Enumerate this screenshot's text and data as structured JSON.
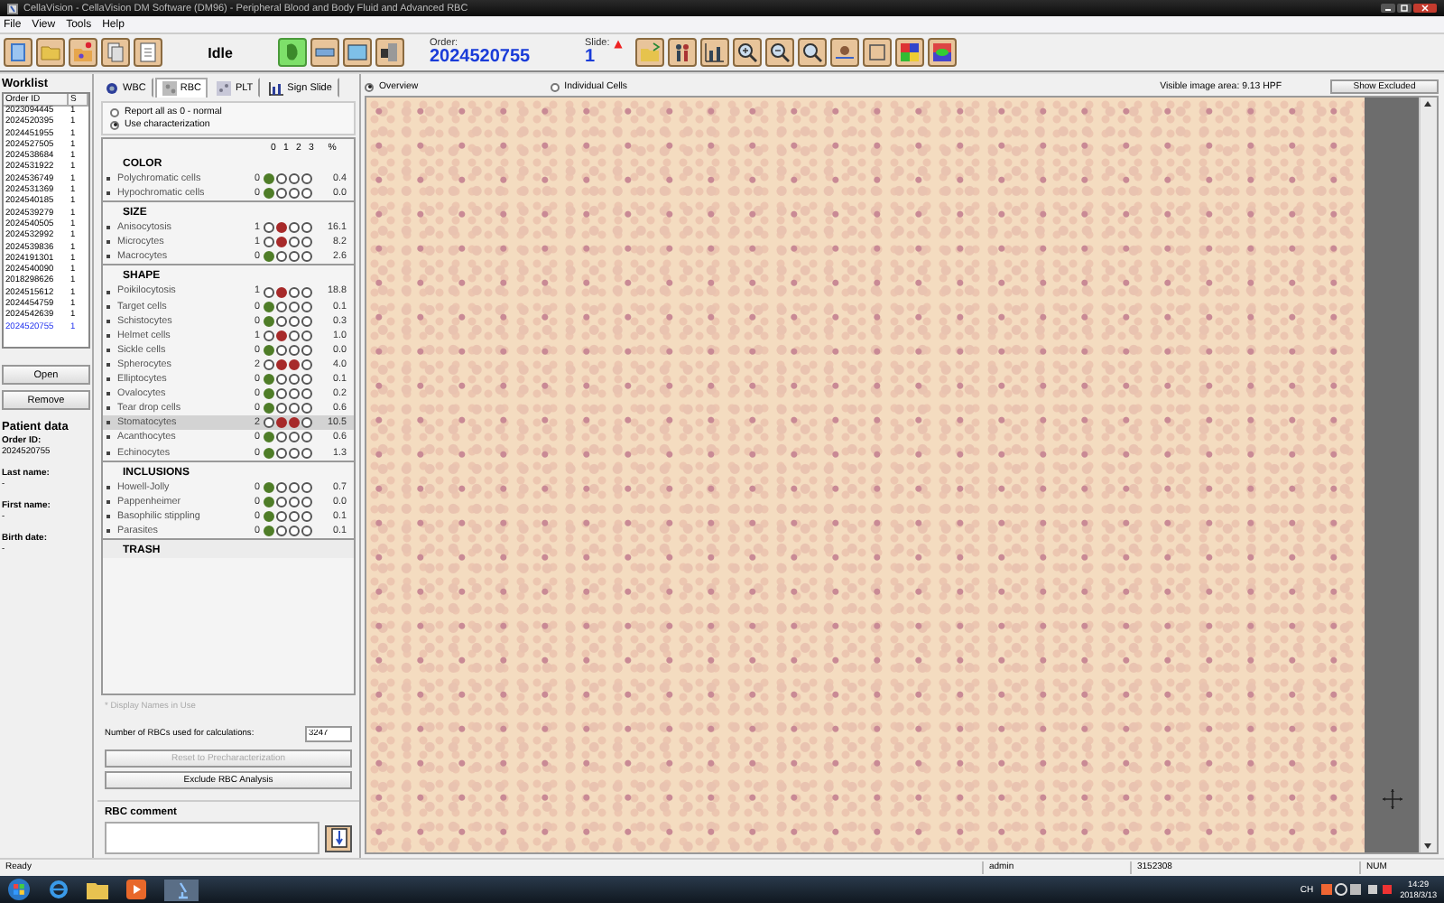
{
  "window": {
    "title": "CellaVision - CellaVision DM Software (DM96) - Peripheral Blood and Body Fluid and Advanced RBC"
  },
  "menu": [
    "File",
    "View",
    "Tools",
    "Help"
  ],
  "toolbar": {
    "status": "Idle",
    "order_label": "Order:",
    "order": "2024520755",
    "slide_label": "Slide:",
    "slide": "1",
    "mode_buttons": [
      {
        "selected": true
      },
      {
        "selected": false
      },
      {
        "selected": false
      },
      {
        "selected": false
      }
    ]
  },
  "worklist": {
    "title": "Worklist",
    "columns": [
      "Order ID",
      "S"
    ],
    "rows": [
      {
        "order": "2023094445",
        "s": "1",
        "selected": false
      },
      {
        "order": "2024520395",
        "s": "1",
        "selected": false
      },
      {
        "order": "2024451955",
        "s": "1",
        "selected": false
      },
      {
        "order": "2024527505",
        "s": "1",
        "selected": false
      },
      {
        "order": "2024538684",
        "s": "1",
        "selected": false
      },
      {
        "order": "2024531922",
        "s": "1",
        "selected": false
      },
      {
        "order": "2024536749",
        "s": "1",
        "selected": false
      },
      {
        "order": "2024531369",
        "s": "1",
        "selected": false
      },
      {
        "order": "2024540185",
        "s": "1",
        "selected": false
      },
      {
        "order": "2024539279",
        "s": "1",
        "selected": false
      },
      {
        "order": "2024540505",
        "s": "1",
        "selected": false
      },
      {
        "order": "2024532992",
        "s": "1",
        "selected": false
      },
      {
        "order": "2024539836",
        "s": "1",
        "selected": false
      },
      {
        "order": "2024191301",
        "s": "1",
        "selected": false
      },
      {
        "order": "2024540090",
        "s": "1",
        "selected": false
      },
      {
        "order": "2018298626",
        "s": "1",
        "selected": false
      },
      {
        "order": "2024515612",
        "s": "1",
        "selected": false
      },
      {
        "order": "2024454759",
        "s": "1",
        "selected": false
      },
      {
        "order": "2024542639",
        "s": "1",
        "selected": false
      },
      {
        "order": "2024520755",
        "s": "1",
        "selected": true
      }
    ],
    "buttons": [
      "Open",
      "Remove"
    ]
  },
  "patient": {
    "title": "Patient data",
    "fields": [
      {
        "label": "Order ID:",
        "value": "2024520755"
      },
      {
        "label": "Last name:",
        "value": "-"
      },
      {
        "label": "First name:",
        "value": "-"
      },
      {
        "label": "Birth date:",
        "value": "-"
      }
    ]
  },
  "tabs": [
    {
      "label": "WBC",
      "selected": false
    },
    {
      "label": "RBC",
      "selected": true
    },
    {
      "label": "PLT",
      "selected": false
    },
    {
      "label": "Sign Slide",
      "selected": false
    }
  ],
  "report_options": [
    {
      "label": "Report all as 0 - normal",
      "selected": false
    },
    {
      "label": "Use characterization",
      "selected": true
    }
  ],
  "grade_header": [
    "0",
    "1",
    "2",
    "3",
    "%"
  ],
  "categories": [
    {
      "title": "COLOR",
      "rows": [
        {
          "name": "Polychromatic cells",
          "grade": "0",
          "percent": "0.4",
          "selected": false
        },
        {
          "name": "Hypochromatic cells",
          "grade": "0",
          "percent": "0.0",
          "selected": false
        }
      ]
    },
    {
      "title": "SIZE",
      "rows": [
        {
          "name": "Anisocytosis",
          "grade": "1",
          "percent": "16.1",
          "selected": false
        },
        {
          "name": "Microcytes",
          "grade": "1",
          "percent": "8.2",
          "selected": false
        },
        {
          "name": "Macrocytes",
          "grade": "0",
          "percent": "2.6",
          "selected": false
        }
      ]
    },
    {
      "title": "SHAPE",
      "rows": [
        {
          "name": "Poikilocytosis",
          "grade": "1",
          "percent": "18.8",
          "selected": false
        },
        {
          "name": "Target cells",
          "grade": "0",
          "percent": "0.1",
          "selected": false
        },
        {
          "name": "Schistocytes",
          "grade": "0",
          "percent": "0.3",
          "selected": false
        },
        {
          "name": "Helmet cells",
          "grade": "1",
          "percent": "1.0",
          "selected": false
        },
        {
          "name": "Sickle cells",
          "grade": "0",
          "percent": "0.0",
          "selected": false
        },
        {
          "name": "Spherocytes",
          "grade": "2",
          "percent": "4.0",
          "selected": false
        },
        {
          "name": "Elliptocytes",
          "grade": "0",
          "percent": "0.1",
          "selected": false
        },
        {
          "name": "Ovalocytes",
          "grade": "0",
          "percent": "0.2",
          "selected": false
        },
        {
          "name": "Tear drop cells",
          "grade": "0",
          "percent": "0.6",
          "selected": false
        },
        {
          "name": "Stomatocytes",
          "grade": "2",
          "percent": "10.5",
          "selected": true
        },
        {
          "name": "Acanthocytes",
          "grade": "0",
          "percent": "0.6",
          "selected": false
        },
        {
          "name": "Echinocytes",
          "grade": "0",
          "percent": "1.3",
          "selected": false
        }
      ]
    },
    {
      "title": "INCLUSIONS",
      "rows": [
        {
          "name": "Howell-Jolly",
          "grade": "0",
          "percent": "0.7",
          "selected": false
        },
        {
          "name": "Pappenheimer",
          "grade": "0",
          "percent": "0.0",
          "selected": false
        },
        {
          "name": "Basophilic stippling",
          "grade": "0",
          "percent": "0.1",
          "selected": false
        },
        {
          "name": "Parasites",
          "grade": "0",
          "percent": "0.1",
          "selected": false
        }
      ]
    },
    {
      "title": "TRASH"
    }
  ],
  "display_note": "* Display Names in Use",
  "rbc_count": {
    "label": "Number of RBCs used for calculations:",
    "value": "3247"
  },
  "action_buttons": [
    {
      "label": "Reset to Precharacterization",
      "disabled": true
    },
    {
      "label": "Exclude RBC Analysis",
      "disabled": false
    }
  ],
  "comment": {
    "title": "RBC comment"
  },
  "view": {
    "options": [
      {
        "label": "Overview",
        "selected": true
      },
      {
        "label": "Individual Cells",
        "selected": false
      }
    ],
    "visible_area": "Visible image area: 9.13 HPF",
    "show_excluded": "Show Excluded"
  },
  "status_bar": {
    "text": "Ready",
    "user": "admin",
    "code": "3152308",
    "key": "NUM"
  },
  "taskbar": {
    "ime": "CH",
    "time": "14:29",
    "date": "2018/3/13"
  }
}
